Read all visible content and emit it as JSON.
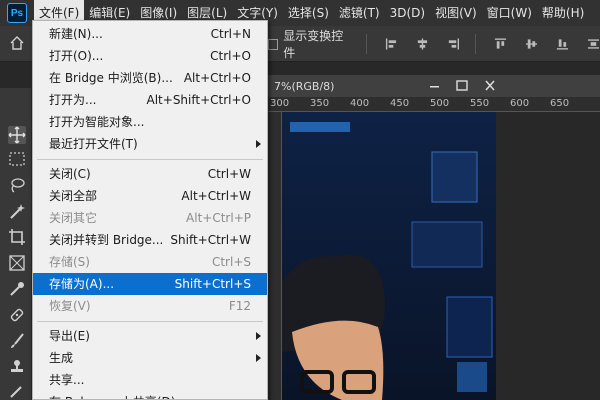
{
  "app": {
    "logo_text": "Ps"
  },
  "menubar": {
    "items": [
      {
        "label": "文件(F)"
      },
      {
        "label": "编辑(E)"
      },
      {
        "label": "图像(I)"
      },
      {
        "label": "图层(L)"
      },
      {
        "label": "文字(Y)"
      },
      {
        "label": "选择(S)"
      },
      {
        "label": "滤镜(T)"
      },
      {
        "label": "3D(D)"
      },
      {
        "label": "视图(V)"
      },
      {
        "label": "窗口(W)"
      },
      {
        "label": "帮助(H)"
      }
    ]
  },
  "options": {
    "show_transform_label": "显示变换控件"
  },
  "document": {
    "tab_title": "7%(RGB/8)",
    "ruler_labels": [
      "300",
      "350",
      "400",
      "450",
      "500",
      "550",
      "600",
      "650"
    ]
  },
  "file_menu": {
    "groups": [
      [
        {
          "label": "新建(N)...",
          "shortcut": "Ctrl+N",
          "disabled": false
        },
        {
          "label": "打开(O)...",
          "shortcut": "Ctrl+O",
          "disabled": false
        },
        {
          "label": "在 Bridge 中浏览(B)...",
          "shortcut": "Alt+Ctrl+O",
          "disabled": false
        },
        {
          "label": "打开为...",
          "shortcut": "Alt+Shift+Ctrl+O",
          "disabled": false
        },
        {
          "label": "打开为智能对象...",
          "shortcut": "",
          "disabled": false
        },
        {
          "label": "最近打开文件(T)",
          "shortcut": "",
          "submenu": true,
          "disabled": false
        }
      ],
      [
        {
          "label": "关闭(C)",
          "shortcut": "Ctrl+W",
          "disabled": false
        },
        {
          "label": "关闭全部",
          "shortcut": "Alt+Ctrl+W",
          "disabled": false
        },
        {
          "label": "关闭其它",
          "shortcut": "Alt+Ctrl+P",
          "disabled": true
        },
        {
          "label": "关闭并转到 Bridge...",
          "shortcut": "Shift+Ctrl+W",
          "disabled": false
        },
        {
          "label": "存储(S)",
          "shortcut": "Ctrl+S",
          "disabled": true
        },
        {
          "label": "存储为(A)...",
          "shortcut": "Shift+Ctrl+S",
          "disabled": false,
          "highlighted": true
        },
        {
          "label": "恢复(V)",
          "shortcut": "F12",
          "disabled": true
        }
      ],
      [
        {
          "label": "导出(E)",
          "shortcut": "",
          "submenu": true,
          "disabled": false
        },
        {
          "label": "生成",
          "shortcut": "",
          "submenu": true,
          "disabled": false
        },
        {
          "label": "共享...",
          "shortcut": "",
          "disabled": false
        },
        {
          "label": "在 Behance 上共享(D)...",
          "shortcut": "",
          "disabled": false
        }
      ]
    ]
  },
  "colors": {
    "highlight": "#0b6fd0",
    "menu_bg": "#f0f0f0",
    "app_bg": "#282828",
    "ps_blue": "#31a8ff"
  }
}
